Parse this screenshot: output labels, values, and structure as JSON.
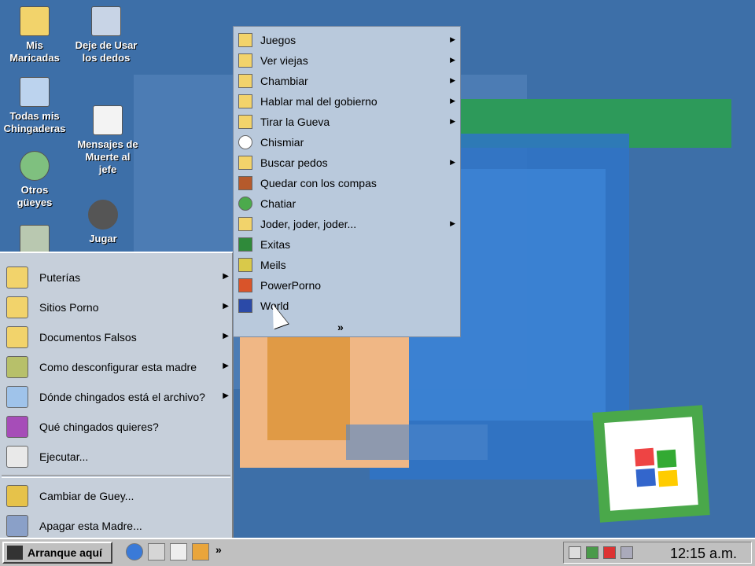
{
  "desktop_icons": [
    {
      "label": "Mis Maricadas",
      "icon": "folder-icon"
    },
    {
      "label": "Deje de Usar los dedos",
      "icon": "calculator-icon"
    },
    {
      "label": "Todas mis Chingaderas",
      "icon": "computer-icon"
    },
    {
      "label": "Mensajes de Muerte al jefe",
      "icon": "notepad-icon"
    },
    {
      "label": "Otros güeyes",
      "icon": "network-icon"
    },
    {
      "label": "Jugar",
      "icon": "gear-icon"
    },
    {
      "label": "",
      "icon": "recycle-bin-icon"
    }
  ],
  "start_menu": {
    "items": [
      {
        "label": "Puterías",
        "icon": "programs-icon",
        "has_submenu": true
      },
      {
        "label": "Sitios Porno",
        "icon": "favorites-icon",
        "has_submenu": true
      },
      {
        "label": "Documentos Falsos",
        "icon": "documents-icon",
        "has_submenu": true
      },
      {
        "label": "Como desconfigurar esta madre",
        "icon": "settings-icon",
        "has_submenu": true
      },
      {
        "label": "Dónde chingados está el archivo?",
        "icon": "search-icon",
        "has_submenu": true
      },
      {
        "label": "Qué chingados quieres?",
        "icon": "help-icon",
        "has_submenu": false
      },
      {
        "label": "Ejecutar...",
        "icon": "run-icon",
        "has_submenu": false
      },
      {
        "label": "Cambiar de Guey...",
        "icon": "logoff-icon",
        "has_submenu": false
      },
      {
        "label": "Apagar esta Madre...",
        "icon": "shutdown-icon",
        "has_submenu": false
      }
    ]
  },
  "submenu": {
    "items": [
      {
        "label": "Juegos",
        "icon": "program-group-icon",
        "has_submenu": true
      },
      {
        "label": "Ver viejas",
        "icon": "program-group-icon",
        "has_submenu": true
      },
      {
        "label": "Chambiar",
        "icon": "program-group-icon",
        "has_submenu": true
      },
      {
        "label": "Hablar mal del gobierno",
        "icon": "program-group-icon",
        "has_submenu": true
      },
      {
        "label": "Tirar la Gueva",
        "icon": "program-group-icon",
        "has_submenu": true
      },
      {
        "label": "Chismiar",
        "icon": "chat-icon",
        "has_submenu": false
      },
      {
        "label": "Buscar pedos",
        "icon": "program-group-icon",
        "has_submenu": true
      },
      {
        "label": "Quedar con los compas",
        "icon": "briefcase-icon",
        "has_submenu": false
      },
      {
        "label": "Chatiar",
        "icon": "messenger-icon",
        "has_submenu": false
      },
      {
        "label": "Joder, joder, joder...",
        "icon": "program-group-icon",
        "has_submenu": true
      },
      {
        "label": "Exitas",
        "icon": "excel-icon",
        "has_submenu": false
      },
      {
        "label": "Meils",
        "icon": "outlook-icon",
        "has_submenu": false
      },
      {
        "label": "PowerPorno",
        "icon": "powerpoint-icon",
        "has_submenu": false
      },
      {
        "label": "World",
        "icon": "word-icon",
        "has_submenu": false
      }
    ],
    "expand": "»"
  },
  "taskbar": {
    "start_label": "Arranque aquí",
    "quick_launch_more": "»",
    "clock": "12:15 a.m."
  },
  "colors": {
    "desktop": "#3d6fa8",
    "menu": "#c6cfda",
    "submenu": "#b9c9dc",
    "taskbar": "#c0c0c0"
  }
}
